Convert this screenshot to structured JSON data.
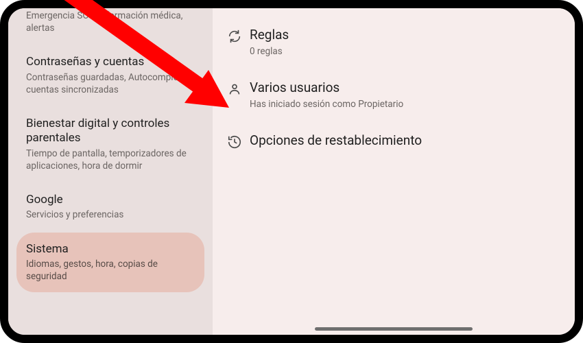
{
  "sidebar": {
    "items": [
      {
        "title": "",
        "subtitle": "Emergencia SOS, información médica, alertas"
      },
      {
        "title": "Contraseñas y cuentas",
        "subtitle": "Contraseñas guardadas, Autocompletar, cuentas sincronizadas"
      },
      {
        "title": "Bienestar digital y controles parentales",
        "subtitle": "Tiempo de pantalla, temporizadores de aplicaciones, hora de dormir"
      },
      {
        "title": "Google",
        "subtitle": "Servicios y preferencias"
      },
      {
        "title": "Sistema",
        "subtitle": "Idiomas, gestos, hora, copias de seguridad"
      }
    ]
  },
  "main": {
    "items": [
      {
        "icon": "sync-icon",
        "title": "Reglas",
        "subtitle": "0 reglas"
      },
      {
        "icon": "person-icon",
        "title": "Varios usuarios",
        "subtitle": "Has iniciado sesión como Propietario"
      },
      {
        "icon": "history-icon",
        "title": "Opciones de restablecimiento",
        "subtitle": ""
      }
    ]
  },
  "annotation": {
    "arrow_color": "#FF0000"
  }
}
